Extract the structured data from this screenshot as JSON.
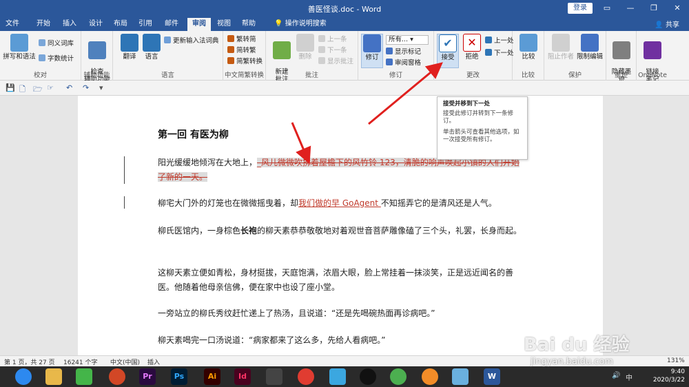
{
  "window": {
    "title": "善医怪谈.doc - Word",
    "login": "登录",
    "controls": [
      "▭",
      "—",
      "❐",
      "✕"
    ]
  },
  "tabs": [
    "文件",
    "开始",
    "插入",
    "设计",
    "布局",
    "引用",
    "邮件",
    "审阅",
    "视图",
    "帮助",
    "操作说明搜索"
  ],
  "share": "共享",
  "ribbon": {
    "groups": {
      "proofing": {
        "label": "校对",
        "spelling": "拼写和语法",
        "thesaurus": "同义词库",
        "wordcount": "字数统计"
      },
      "accessibility": {
        "label": "辅助功能",
        "check": "检查\n辅助功能"
      },
      "language": {
        "label": "语言",
        "translate": "翻译",
        "lang": "语言",
        "update_ime": "更新输入法词典"
      },
      "chinese": {
        "label": "中文简繁转换",
        "to_trad": "繁转简",
        "to_simp": "简转繁",
        "convert": "简繁转换"
      },
      "comments": {
        "label": "批注",
        "new": "新建\n批注",
        "delete": "删除",
        "prev": "上一条",
        "next": "下一条",
        "show": "显示批注"
      },
      "tracking": {
        "label": "修订",
        "track": "修订",
        "markup": "所有...",
        "show_markup": "显示标记",
        "pane": "审阅窗格"
      },
      "changes": {
        "label": "更改",
        "accept": "接受",
        "reject": "拒绝",
        "prev": "上一处",
        "next": "下一处"
      },
      "compare": {
        "label": "比较",
        "compare": "比较"
      },
      "protect": {
        "label": "保护",
        "block": "阻止作者",
        "restrict": "限制编辑"
      },
      "ink": {
        "label": "墨迹",
        "hide": "隐藏墨\n迹"
      },
      "onenote": {
        "label": "OneNote",
        "link": "链接\n笔记"
      }
    }
  },
  "tooltip": {
    "title": "接受并移到下一处",
    "line1": "接受此修订并转到下一条修订。",
    "line2": "单击箭头可查看其他选项，如一次接受所有修订。"
  },
  "document": {
    "heading": "第一回  有医为柳",
    "p1_start": "阳光缓缓地倾泻在大地上，",
    "p1_deleted": "_风儿微微吹拂着屋檐下的风竹铃 123，清脆的响声唤起小镇的人们开始了新的一天。",
    "p2_start": "柳宅大门外的灯笼也在微微摇曳着，却",
    "p2_inserted": "我们做的早 GoAgent ",
    "p2_end": "不知摇弄它的是清风还是人气。",
    "p3_a": "柳氏医馆内，一身棕色",
    "p3_bold": "长袍",
    "p3_b": "的柳天素恭恭敬敬地对着观世音菩萨雕像磕了三个头，礼罢，长身而起。",
    "p4": "这柳天素立便如青松，身材挺拔，天庭饱满，浓眉大眼，脸上常挂着一抹淡笑，正是远近闻名的善医。他随着他母亲信佛，便在家中也设了座小堂。",
    "p5": "一旁站立的柳氏秀纹赶忙递上了热汤，且说道：“还是先喝碗热面再诊病吧。”",
    "p6": "柳天素喝完一口汤说道：“病家都来了这么多，先给人看病吧。”"
  },
  "status": {
    "page": "第 1 页，共 27 页",
    "words": "16241 个字",
    "lang": "中文(中国)",
    "mode": "插入",
    "zoom": "131%"
  },
  "taskbar": {
    "apps": [
      "Pr",
      "Ps",
      "Ai",
      "Id",
      "W"
    ],
    "time": "9:40",
    "date": "2020/3/22",
    "ime": "中"
  },
  "watermark": {
    "brand": "Bai du 经验",
    "url": "jingyan.baidu.com"
  }
}
